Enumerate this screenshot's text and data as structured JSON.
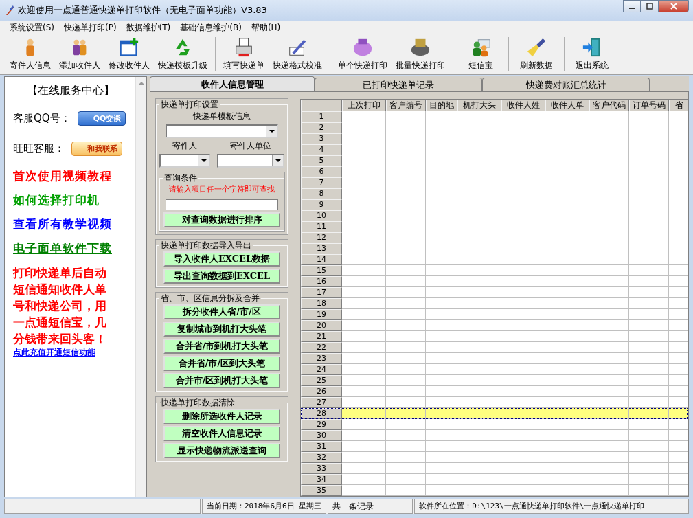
{
  "window": {
    "title": "欢迎使用一点通普通快递单打印软件（无电子面单功能）V3.83"
  },
  "menu": [
    "系统设置(S)",
    "快递单打印(P)",
    "数据维护(T)",
    "基础信息维护(B)",
    "帮助(H)"
  ],
  "toolbar": [
    [
      "寄件人信息",
      "添加收件人",
      "修改收件人",
      "快递模板升级"
    ],
    [
      "填写快递单",
      "快递格式校准"
    ],
    [
      "单个快递打印",
      "批量快递打印"
    ],
    [
      "短信宝"
    ],
    [
      "刷新数据"
    ],
    [
      "退出系统"
    ]
  ],
  "sidebar": {
    "heading": "【在线服务中心】",
    "contacts": [
      {
        "label": "客服QQ号：",
        "button": "QQ交谈",
        "kind": "qq"
      },
      {
        "label": "旺旺客服：",
        "button": "和我联系",
        "kind": "wangwang"
      }
    ],
    "links": [
      {
        "text": "首次使用视频教程",
        "color": "#ff0000"
      },
      {
        "text": "如何选择打印机",
        "color": "#00a000"
      },
      {
        "text": "查看所有教学视频",
        "color": "#0000ff"
      },
      {
        "text": "电子面单软件下载",
        "color": "#008000"
      }
    ],
    "promo": "打印快递单后自动短信通知收件人单号和快递公司，用一点通短信宝，几分钱带来回头客！",
    "promo_link": "点此充值开通短信功能"
  },
  "tabs": [
    {
      "label": "收件人信息管理",
      "selected": true
    },
    {
      "label": "已打印快递单记录",
      "selected": false
    },
    {
      "label": "快递费对账汇总统计",
      "selected": false
    }
  ],
  "print_settings": {
    "title": "快递单打印设置",
    "template_label": "快递单模板信息",
    "sender_label": "寄件人",
    "sender_unit_label": "寄件人单位"
  },
  "query": {
    "title": "查询条件",
    "hint": "请输入项目任一个字符即可查找",
    "button": "对查询数据进行排序"
  },
  "groups": [
    {
      "title": "快递单打印数据导入导出",
      "buttons": [
        "导入收件人EXCEL数据",
        "导出查询数据到EXCEL"
      ]
    },
    {
      "title": "省、市、区信息分拆及合并",
      "buttons": [
        "拆分收件人省/市/区",
        "复制城市到机打大头笔",
        "合并省/市到机打大头笔",
        "合并省/市/区到大头笔",
        "合并市/区到机打大头笔"
      ]
    },
    {
      "title": "快递单打印数据清除",
      "buttons": [
        "删除所选收件人记录",
        "清空收件人信息记录",
        "显示快递物流派送查询"
      ]
    }
  ],
  "table": {
    "columns": [
      "上次打印",
      "客户编号",
      "目的地",
      "机打大头",
      "收件人姓",
      "收件人单",
      "客户代码",
      "订单号码",
      "省"
    ],
    "rows": [
      {
        "number": "1",
        "selected": false
      },
      {
        "number": "2",
        "selected": false
      },
      {
        "number": "3",
        "selected": false
      },
      {
        "number": "4",
        "selected": false
      },
      {
        "number": "5",
        "selected": false
      },
      {
        "number": "6",
        "selected": false
      },
      {
        "number": "7",
        "selected": false
      },
      {
        "number": "8",
        "selected": false
      },
      {
        "number": "9",
        "selected": false
      },
      {
        "number": "10",
        "selected": false
      },
      {
        "number": "11",
        "selected": false
      },
      {
        "number": "12",
        "selected": false
      },
      {
        "number": "13",
        "selected": false
      },
      {
        "number": "14",
        "selected": false
      },
      {
        "number": "15",
        "selected": false
      },
      {
        "number": "16",
        "selected": false
      },
      {
        "number": "17",
        "selected": false
      },
      {
        "number": "18",
        "selected": false
      },
      {
        "number": "19",
        "selected": false
      },
      {
        "number": "20",
        "selected": false
      },
      {
        "number": "21",
        "selected": false
      },
      {
        "number": "22",
        "selected": false
      },
      {
        "number": "23",
        "selected": false
      },
      {
        "number": "24",
        "selected": false
      },
      {
        "number": "25",
        "selected": false
      },
      {
        "number": "26",
        "selected": false
      },
      {
        "number": "27",
        "selected": false
      },
      {
        "number": "28",
        "selected": true
      },
      {
        "number": "29",
        "selected": false
      },
      {
        "number": "30",
        "selected": false
      },
      {
        "number": "31",
        "selected": false
      },
      {
        "number": "32",
        "selected": false
      },
      {
        "number": "33",
        "selected": false
      },
      {
        "number": "34",
        "selected": false
      },
      {
        "number": "35",
        "selected": false
      }
    ]
  },
  "status_bar": [
    "当前日期：2018年6月6日 星期三",
    "共　条记录",
    "软件所在位置：D:\\123\\一点通快递单打印软件\\一点通快递单打印"
  ]
}
